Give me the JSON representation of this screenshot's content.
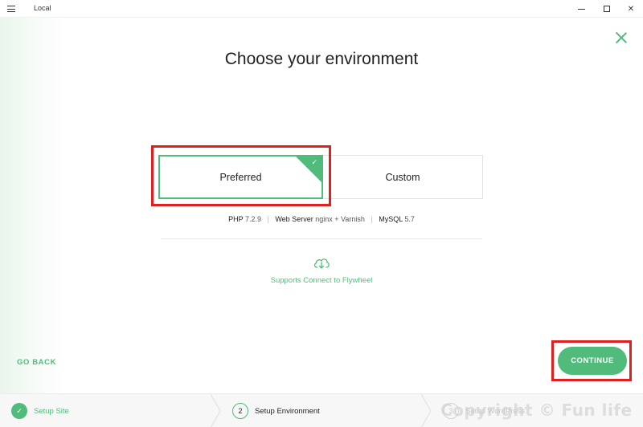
{
  "window": {
    "title": "Local",
    "minimize_icon": "minimize-icon",
    "maximize_icon": "maximize-icon",
    "close_icon": "close-icon"
  },
  "page": {
    "heading": "Choose your environment",
    "close_icon": "close-x-icon"
  },
  "environment": {
    "options": [
      {
        "label": "Preferred",
        "selected": true
      },
      {
        "label": "Custom",
        "selected": false
      }
    ],
    "check_icon": "checkmark-icon"
  },
  "specs": {
    "php_label": "PHP",
    "php_version": "7.2.9",
    "server_label": "Web Server",
    "server_value": "nginx + Varnish",
    "mysql_label": "MySQL",
    "mysql_version": "5.7"
  },
  "flywheel": {
    "icon": "flywheel-cloud-icon",
    "text": "Supports Connect to Flywheel"
  },
  "actions": {
    "go_back": "GO BACK",
    "continue": "CONTINUE"
  },
  "steps": [
    {
      "number": "✓",
      "label": "Setup Site",
      "state": "done"
    },
    {
      "number": "2",
      "label": "Setup Environment",
      "state": "active"
    },
    {
      "number": "3",
      "label": "Setup WordPress",
      "state": "pending"
    }
  ],
  "watermark": "Copyright © Fun life",
  "colors": {
    "accent": "#51bb7b",
    "highlight": "#e0201f"
  }
}
